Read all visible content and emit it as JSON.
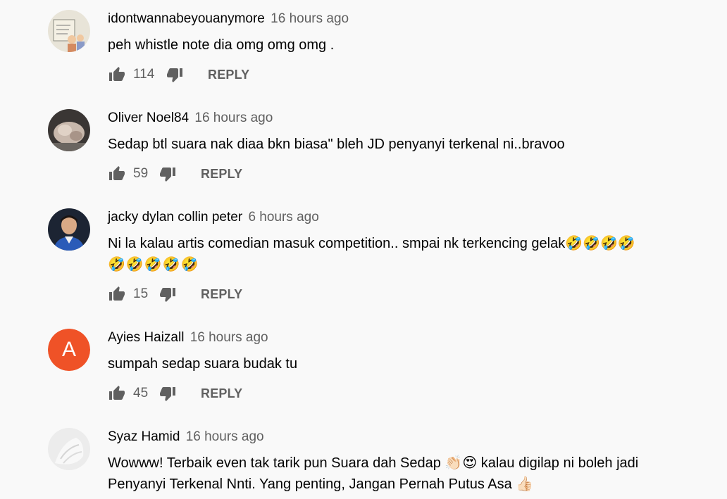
{
  "reply_label": "REPLY",
  "comments": [
    {
      "author": "idontwannabeyouanymore",
      "time": "16 hours ago",
      "text": "peh whistle note dia omg omg omg .",
      "likes": "114",
      "avatar": "cartoon-drawing"
    },
    {
      "author": "Oliver Noel84",
      "time": "16 hours ago",
      "text": "Sedap btl suara nak diaa bkn biasa\" bleh JD penyanyi terkenal ni..bravoo",
      "likes": "59",
      "avatar": "photo-hand"
    },
    {
      "author": "jacky dylan collin peter",
      "time": "6 hours ago",
      "text": "Ni la kalau artis comedian masuk competition.. smpai nk terkencing gelak🤣🤣🤣🤣",
      "text2": "🤣🤣🤣🤣🤣",
      "likes": "15",
      "avatar": "photo-man"
    },
    {
      "author": "Ayies Haizall",
      "time": "16 hours ago",
      "text": "sumpah sedap suara budak tu",
      "likes": "45",
      "avatar_letter": "A",
      "avatar_color": "#ef5227"
    },
    {
      "author": "Syaz Hamid",
      "time": "16 hours ago",
      "text": "Wowww! Terbaik even tak tarik pun Suara dah Sedap 👏🏻😍 kalau digilap ni boleh jadi",
      "text2": "Penyanyi Terkenal Nnti. Yang penting, Jangan Pernah Putus Asa 👍🏻",
      "avatar": "photo-white"
    }
  ]
}
